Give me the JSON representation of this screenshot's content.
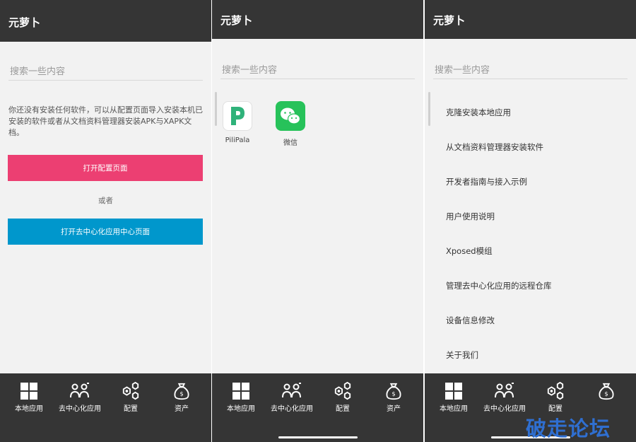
{
  "app_title": "元萝卜",
  "search": {
    "placeholder": "搜索一些内容"
  },
  "screen1": {
    "hint": "你还没有安装任何软件，可以从配置页面导入安装本机已安装的软件或者从文档资料管理器安装APK与XAPK文档。",
    "btn_config": "打开配置页面",
    "or": "或者",
    "btn_decentral": "打开去中心化应用中心页面"
  },
  "screen2": {
    "apps": [
      {
        "name": "PiliPala",
        "icon": "pilipala-icon"
      },
      {
        "name": "微信",
        "icon": "wechat-icon"
      }
    ]
  },
  "screen3": {
    "menu": [
      "克隆安装本地应用",
      "从文档资料管理器安装软件",
      "开发者指南与接入示例",
      "用户使用说明",
      "Xposed模组",
      "管理去中心化应用的远程仓库",
      "设备信息修改",
      "关于我们"
    ]
  },
  "nav": [
    {
      "label": "本地应用",
      "icon": "grid-icon"
    },
    {
      "label": "去中心化应用",
      "icon": "users-icon"
    },
    {
      "label": "配置",
      "icon": "gears-icon"
    },
    {
      "label": "资产",
      "icon": "money-bag-icon"
    }
  ],
  "watermark": "破走论坛",
  "colors": {
    "bar": "#353535",
    "pink": "#ec3f72",
    "blue": "#0097cc",
    "wechat": "#27c25a"
  }
}
